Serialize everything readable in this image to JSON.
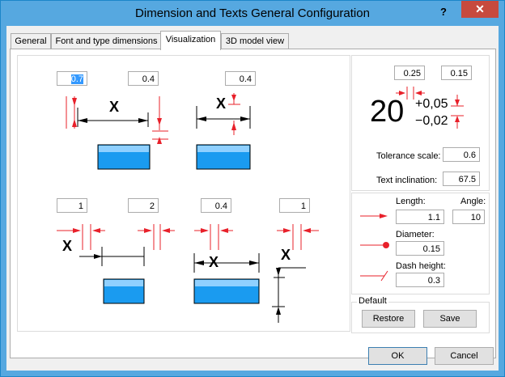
{
  "window": {
    "title": "Dimension and Texts General Configuration",
    "help": "?",
    "close": "✕"
  },
  "tabs": [
    {
      "label": "General"
    },
    {
      "label": "Font and type dimensions"
    },
    {
      "label": "Visualization"
    },
    {
      "label": "3D model view"
    }
  ],
  "preview": {
    "top_left": {
      "field1": "0.7",
      "field2": "0.4",
      "letter": "X"
    },
    "top_right": {
      "field": "0.4",
      "letter": "X"
    },
    "bottom_left": {
      "field1": "1",
      "field2": "2",
      "letter": "X"
    },
    "bottom_right": {
      "field1": "0.4",
      "field2": "1",
      "letter_main": "X",
      "letter_side": "X"
    }
  },
  "tolerance": {
    "field_left": "0.25",
    "field_right": "0.15",
    "big_number": "20",
    "upper": "+0,05",
    "lower": "−0,02",
    "scale_label": "Tolerance scale:",
    "scale_value": "0.6",
    "incl_label": "Text inclination:",
    "incl_value": "67.5"
  },
  "arrow": {
    "length_label": "Length:",
    "length_value": "1.1",
    "angle_label": "Angle:",
    "angle_value": "10",
    "diameter_label": "Diameter:",
    "diameter_value": "0.15",
    "dash_label": "Dash height:",
    "dash_value": "0.3"
  },
  "default_group": {
    "title": "Default",
    "restore": "Restore",
    "save": "Save"
  },
  "footer": {
    "ok": "OK",
    "cancel": "Cancel"
  },
  "colors": {
    "accent_red": "#e8202a",
    "fill_blue": "#1a9bf0",
    "title_bar": "#56a8e0"
  }
}
